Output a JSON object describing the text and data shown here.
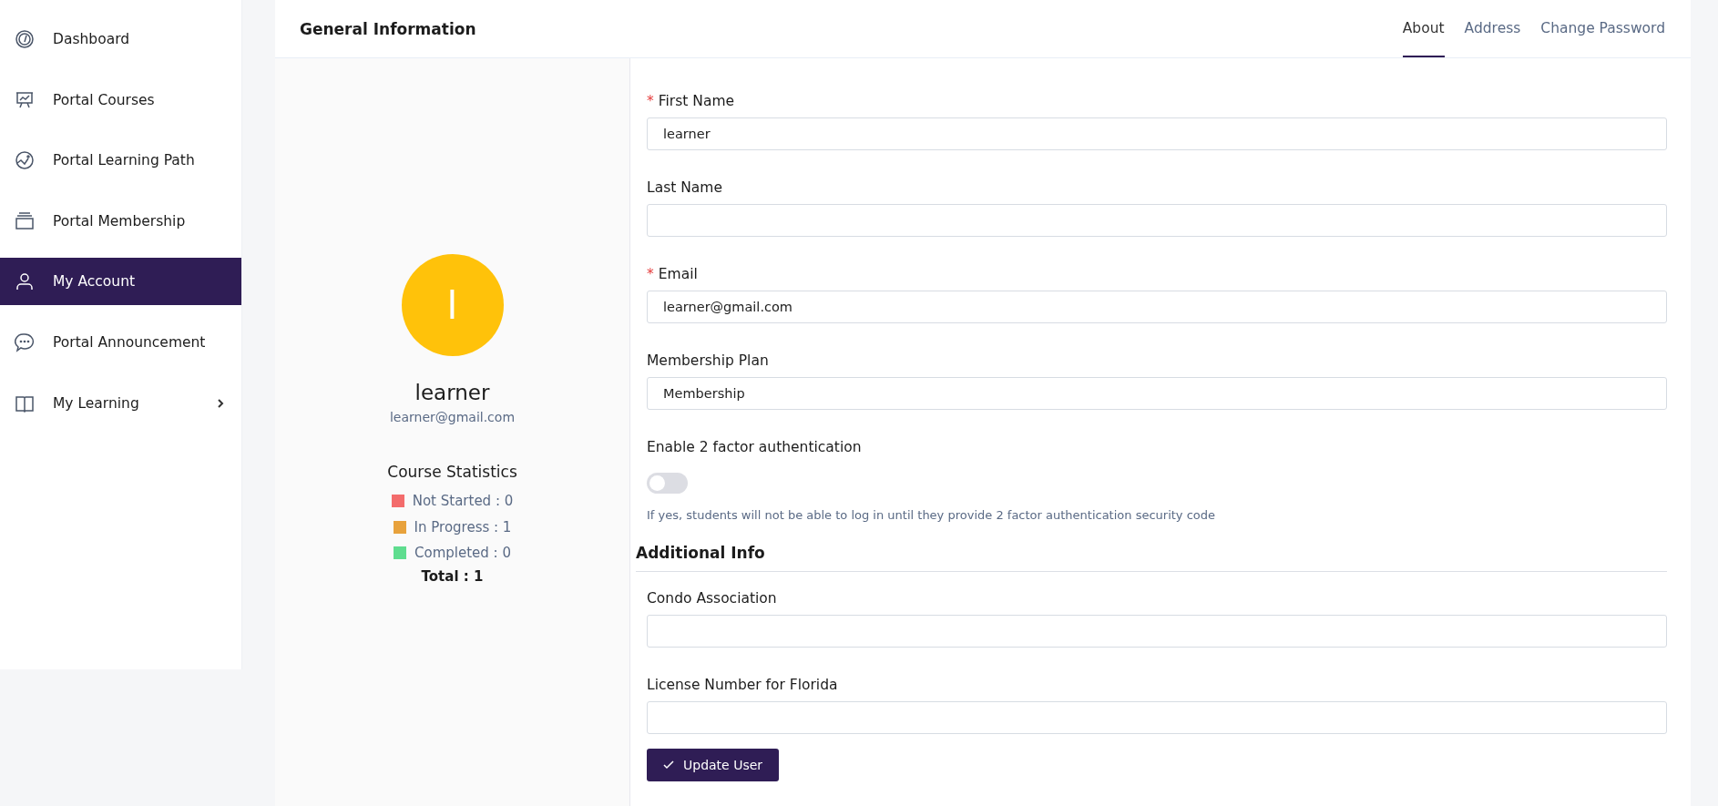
{
  "sidebar": {
    "items": [
      {
        "label": "Dashboard",
        "selected": false,
        "has_submenu": false
      },
      {
        "label": "Portal Courses",
        "selected": false,
        "has_submenu": false
      },
      {
        "label": "Portal Learning Path",
        "selected": false,
        "has_submenu": false
      },
      {
        "label": "Portal Membership",
        "selected": false,
        "has_submenu": false
      },
      {
        "label": "My Account",
        "selected": true,
        "has_submenu": false
      },
      {
        "label": "Portal Announcement",
        "selected": false,
        "has_submenu": false
      },
      {
        "label": "My Learning",
        "selected": false,
        "has_submenu": true
      }
    ]
  },
  "header": {
    "title": "General Information",
    "tabs": [
      {
        "label": "About",
        "selected": true
      },
      {
        "label": "Address",
        "selected": false
      },
      {
        "label": "Change Password",
        "selected": false
      }
    ]
  },
  "profile": {
    "avatar_letter": "l",
    "name": "learner",
    "email": "learner@gmail.com",
    "stats_title": "Course Statistics",
    "stats": [
      {
        "label": "Not Started : 0",
        "color": "#f36c6c"
      },
      {
        "label": "In Progress : 1",
        "color": "#e8a23c"
      },
      {
        "label": "Completed : 0",
        "color": "#5fdd8f"
      }
    ],
    "total": "Total : 1"
  },
  "form": {
    "fields": [
      {
        "label": "First Name",
        "required_mark": "*",
        "value": "learner"
      },
      {
        "label": "Last Name"
      },
      {
        "label": "Email",
        "required_mark": "*",
        "value": "learner@gmail.com"
      },
      {
        "label": "Membership Plan",
        "value": "Membership"
      }
    ],
    "two_factor": {
      "label": "Enable 2 factor authentication",
      "on": false,
      "hint": "If yes, students will not be able to log in until they provide 2 factor authentication security code"
    },
    "section_title": "Additional Info",
    "extra_fields": [
      {
        "label": "Condo Association"
      },
      {
        "label": "License Number for Florida"
      }
    ],
    "submit": "Update User"
  }
}
